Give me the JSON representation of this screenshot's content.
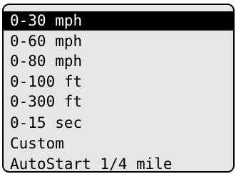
{
  "menu": {
    "selected_index": 0,
    "colors": {
      "background": "#e6e6e6",
      "border": "#000000",
      "selected_background": "#000000",
      "selected_text": "#ffffff",
      "text": "#000000"
    },
    "items": [
      {
        "label": "0-30 mph"
      },
      {
        "label": "0-60 mph"
      },
      {
        "label": "0-80 mph"
      },
      {
        "label": "0-100 ft"
      },
      {
        "label": "0-300 ft"
      },
      {
        "label": "0-15 sec"
      },
      {
        "label": "Custom"
      },
      {
        "label": "AutoStart 1/4 mile"
      }
    ]
  }
}
